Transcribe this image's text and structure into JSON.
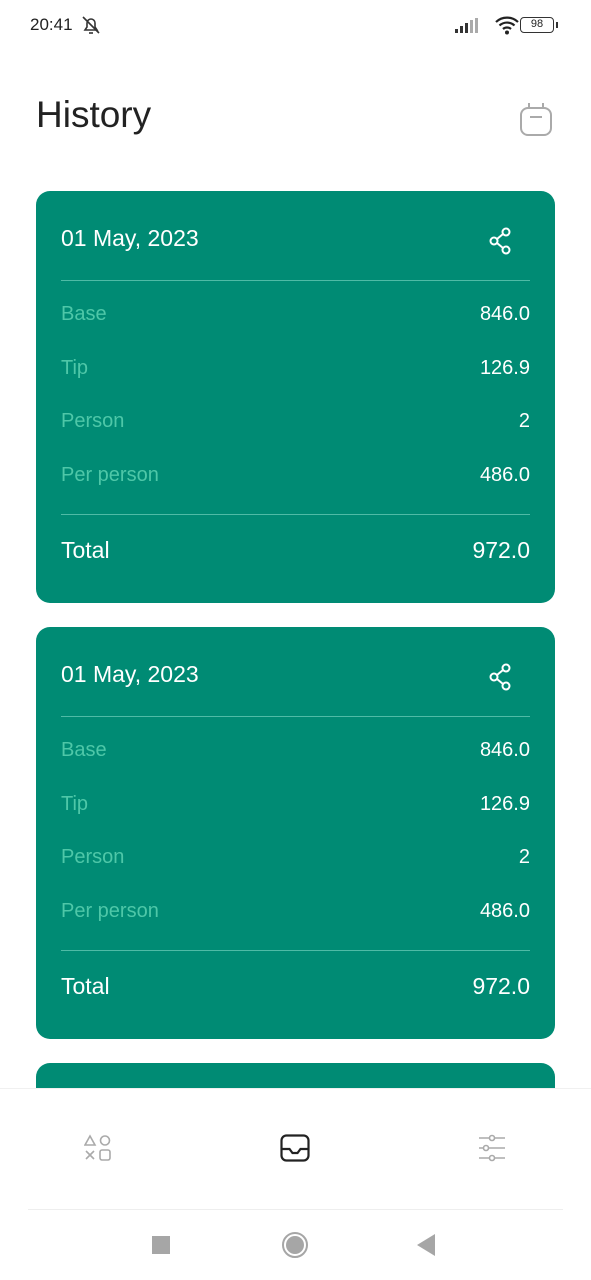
{
  "status_bar": {
    "time": "20:41",
    "battery": "98"
  },
  "header": {
    "title": "History"
  },
  "cards": [
    {
      "date": "01 May, 2023",
      "rows": [
        {
          "label": "Base",
          "value": "846.0"
        },
        {
          "label": "Tip",
          "value": "126.9"
        },
        {
          "label": "Person",
          "value": "2"
        },
        {
          "label": "Per person",
          "value": "486.0"
        }
      ],
      "total_label": "Total",
      "total_value": "972.0"
    },
    {
      "date": "01 May, 2023",
      "rows": [
        {
          "label": "Base",
          "value": "846.0"
        },
        {
          "label": "Tip",
          "value": "126.9"
        },
        {
          "label": "Person",
          "value": "2"
        },
        {
          "label": "Per person",
          "value": "486.0"
        }
      ],
      "total_label": "Total",
      "total_value": "972.0"
    }
  ],
  "colors": {
    "card": "#008b74",
    "label": "#4ec7a8"
  }
}
